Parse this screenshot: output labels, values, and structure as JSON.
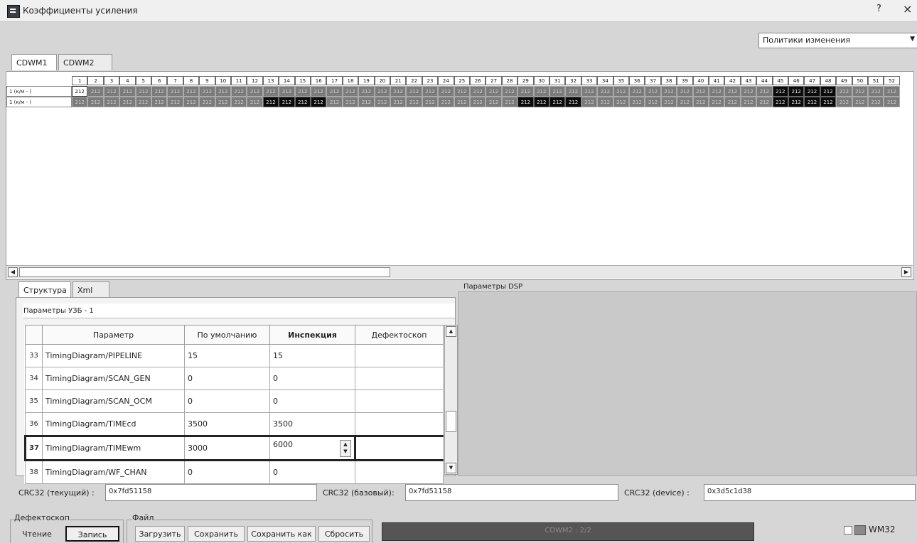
{
  "window": {
    "title": "Коэффициенты усиления",
    "help_label": "?",
    "close_label": "×"
  },
  "policy": {
    "selected": "Политики изменения"
  },
  "top_tabs": [
    {
      "label": "CDWM1"
    },
    {
      "label": "CDWM2"
    }
  ],
  "grid": {
    "columns": [
      "1",
      "2",
      "3",
      "4",
      "5",
      "6",
      "7",
      "8",
      "9",
      "10",
      "11",
      "12",
      "13",
      "14",
      "15",
      "16",
      "17",
      "18",
      "19",
      "20",
      "21",
      "22",
      "23",
      "24",
      "25",
      "26",
      "27",
      "28",
      "29",
      "30",
      "31",
      "32",
      "33",
      "34",
      "35",
      "36",
      "37",
      "38",
      "39",
      "40",
      "41",
      "42",
      "43",
      "44",
      "45",
      "46",
      "47",
      "48",
      "49",
      "50",
      "51",
      "52"
    ],
    "rows": [
      {
        "label": "1 (к/м - )",
        "value": "212",
        "highlighted_columns": [
          45,
          46,
          47,
          48
        ],
        "selected_columns": [
          1
        ]
      },
      {
        "label": "1 (к/м - )",
        "value": "212",
        "highlighted_columns": [
          13,
          14,
          15,
          16,
          29,
          30,
          31,
          32,
          45,
          46,
          47,
          48
        ],
        "selected_columns": []
      }
    ]
  },
  "lower_tabs": [
    {
      "label": "Структура"
    },
    {
      "label": "Xml"
    }
  ],
  "struct_panel": {
    "title": "Параметры УЗБ - 1",
    "headers": {
      "param": "Параметр",
      "default": "По умолчанию",
      "inspection": "Инспекция",
      "detector": "Дефектоскоп"
    },
    "rows": [
      {
        "num": "33",
        "param": "TimingDiagram/PIPELINE",
        "default": "15",
        "inspection": "15",
        "detector": ""
      },
      {
        "num": "34",
        "param": "TimingDiagram/SCAN_GEN",
        "default": "0",
        "inspection": "0",
        "detector": ""
      },
      {
        "num": "35",
        "param": "TimingDiagram/SCAN_OCM",
        "default": "0",
        "inspection": "0",
        "detector": ""
      },
      {
        "num": "36",
        "param": "TimingDiagram/TIMEcd",
        "default": "3500",
        "inspection": "3500",
        "detector": ""
      },
      {
        "num": "37",
        "param": "TimingDiagram/TIMEwm",
        "default": "3000",
        "inspection": "6000",
        "detector": ""
      },
      {
        "num": "38",
        "param": "TimingDiagram/WF_CHAN",
        "default": "0",
        "inspection": "0",
        "detector": ""
      }
    ]
  },
  "dsp": {
    "label": "Параметры DSP"
  },
  "crc": {
    "current_label": "CRC32 (текущий) :",
    "current_value": "0x7fd51158",
    "base_label": "CRC32 (базовый):",
    "base_value": "0x7fd51158",
    "device_label": "CRC32 (device) :",
    "device_value": "0x3d5c1d38"
  },
  "defect_group": {
    "title": "Дефектоскоп",
    "read_label": "Чтение",
    "write_label": "Запись"
  },
  "file_group": {
    "title": "Файл",
    "load_label": "Загрузить",
    "save_label": "Сохранить",
    "save_as_label": "Сохранить как",
    "reset_label": "Сбросить"
  },
  "progress": {
    "text": "CDWM2 : 2/2"
  },
  "wm32": {
    "label": "WM32",
    "checked": false
  }
}
